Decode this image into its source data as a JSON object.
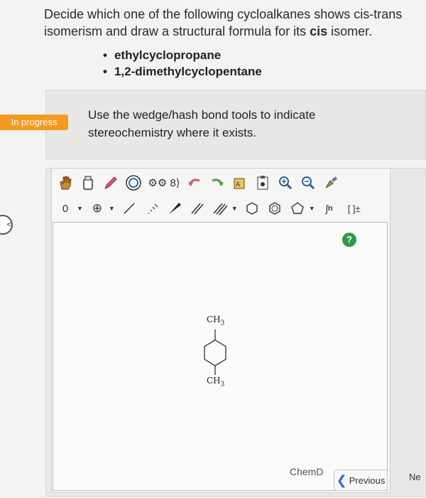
{
  "question": {
    "prefix": "Decide which one of the following cycloalkanes shows cis-trans isomerism and draw a structural formula for its ",
    "emphasis": "cis",
    "suffix": " isomer.",
    "options": [
      "ethylcyclopropane",
      "1,2-dimethylcyclopentane"
    ]
  },
  "status": {
    "label": "In progress",
    "color": "#f39a22"
  },
  "instruction": "Use the wedge/hash bond tools to indicate stereochemistry where it exists.",
  "toolbar": {
    "row1_icons": [
      "hand-icon",
      "eraser-icon",
      "pencil-icon",
      "ring-template-icon",
      "atom-map-icon",
      "undo-icon",
      "redo-icon",
      "copy-icon",
      "clipboard-icon",
      "zoom-in-icon",
      "zoom-out-icon",
      "clean-icon"
    ],
    "charge_label": "0",
    "bracket_label": "[ ]±",
    "repeat_label": "n"
  },
  "molecule": {
    "top_label": "CH3",
    "bottom_label": "CH3"
  },
  "help": "?",
  "brand": "ChemD",
  "nav": {
    "previous": "Previous",
    "next": "Ne"
  }
}
